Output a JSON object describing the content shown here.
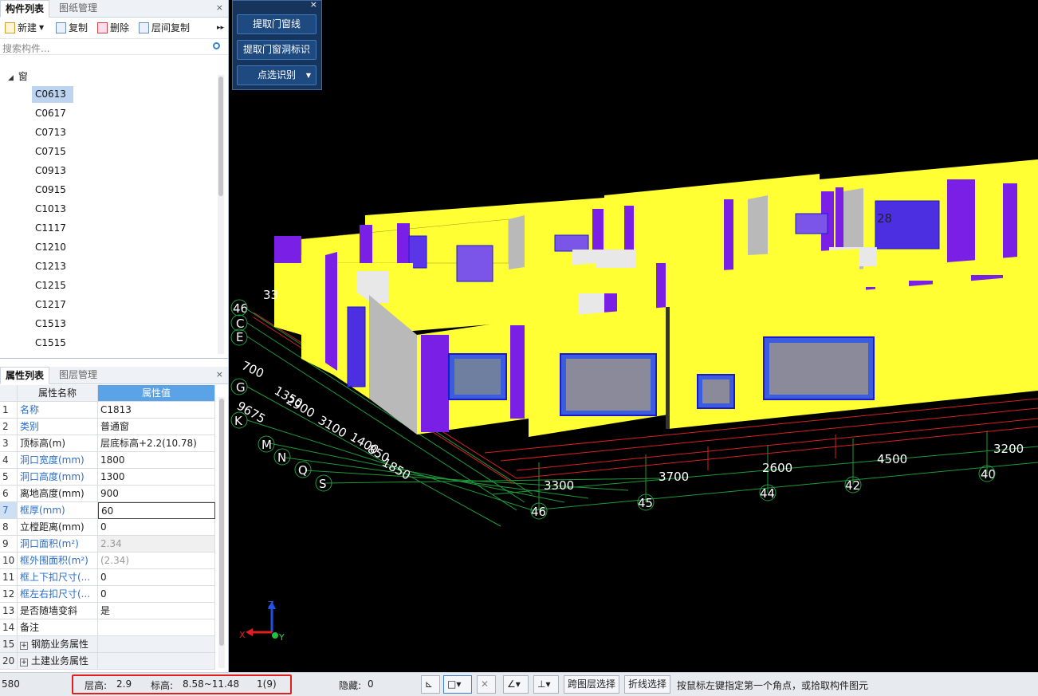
{
  "component_panel": {
    "tabs": [
      "构件列表",
      "图纸管理"
    ],
    "close": "×",
    "toolbar": {
      "new": "新建",
      "copy": "复制",
      "delete": "删除",
      "floor_copy": "层间复制",
      "more": "▸▸"
    },
    "search_placeholder": "搜索构件...",
    "tree_root": "窗",
    "items": [
      "C0613",
      "C0617",
      "C0713",
      "C0715",
      "C0913",
      "C0915",
      "C1013",
      "C1117",
      "C1210",
      "C1213",
      "C1215",
      "C1217",
      "C1513",
      "C1515"
    ]
  },
  "properties_panel": {
    "tabs": [
      "属性列表",
      "图层管理"
    ],
    "close": "×",
    "headers": {
      "name": "属性名称",
      "value": "属性值"
    },
    "rows": [
      {
        "n": "1",
        "name": "名称",
        "value": "C1813"
      },
      {
        "n": "2",
        "name": "类别",
        "value": "普通窗"
      },
      {
        "n": "3",
        "name": "顶标高(m)",
        "value": "层底标高+2.2(10.78)"
      },
      {
        "n": "4",
        "name": "洞口宽度(mm)",
        "value": "1800"
      },
      {
        "n": "5",
        "name": "洞口高度(mm)",
        "value": "1300"
      },
      {
        "n": "6",
        "name": "离地高度(mm)",
        "value": "900"
      },
      {
        "n": "7",
        "name": "框厚(mm)",
        "value": "60"
      },
      {
        "n": "8",
        "name": "立樘距离(mm)",
        "value": "0"
      },
      {
        "n": "9",
        "name": "洞口面积(m²)",
        "value": "2.34"
      },
      {
        "n": "10",
        "name": "框外围面积(m²)",
        "value": "(2.34)"
      },
      {
        "n": "11",
        "name": "框上下扣尺寸(...",
        "value": "0"
      },
      {
        "n": "12",
        "name": "框左右扣尺寸(...",
        "value": "0"
      },
      {
        "n": "13",
        "name": "是否随墙变斜",
        "value": "是"
      },
      {
        "n": "14",
        "name": "备注",
        "value": ""
      },
      {
        "n": "15",
        "name": "钢筋业务属性",
        "value": ""
      },
      {
        "n": "20",
        "name": "土建业务属性",
        "value": ""
      }
    ]
  },
  "floating_panel": {
    "close": "×",
    "buttons": [
      "提取门窗线",
      "提取门窗洞标识",
      "点选识别"
    ]
  },
  "viewport": {
    "axis_labels_left": [
      "46",
      "C",
      "E",
      "G",
      "K",
      "M",
      "N",
      "Q",
      "S"
    ],
    "axis_labels_bottom": [
      "46",
      "45",
      "44",
      "42",
      "40"
    ],
    "dims_left": [
      "700",
      "1350",
      "2900",
      "9675",
      "3100",
      "1400",
      "850",
      "1850",
      "33"
    ],
    "dims_bottom": [
      "3300",
      "3700",
      "2600",
      "4500",
      "3200"
    ],
    "room_number": "28",
    "axis_gizmo": {
      "x": "X",
      "y": "Y",
      "z": "Z"
    }
  },
  "status_bar": {
    "left_value": "580",
    "floor_height_label": "层高:",
    "floor_height": "2.9",
    "elevation_label": "标高:",
    "elevation": "8.58~11.48",
    "count": "1(9)",
    "hidden_label": "隐藏:",
    "hidden": "0",
    "cross_floor_select": "跨图层选择",
    "polyline_select": "折线选择",
    "hint": "按鼠标左键指定第一个角点，或拾取构件图元"
  }
}
